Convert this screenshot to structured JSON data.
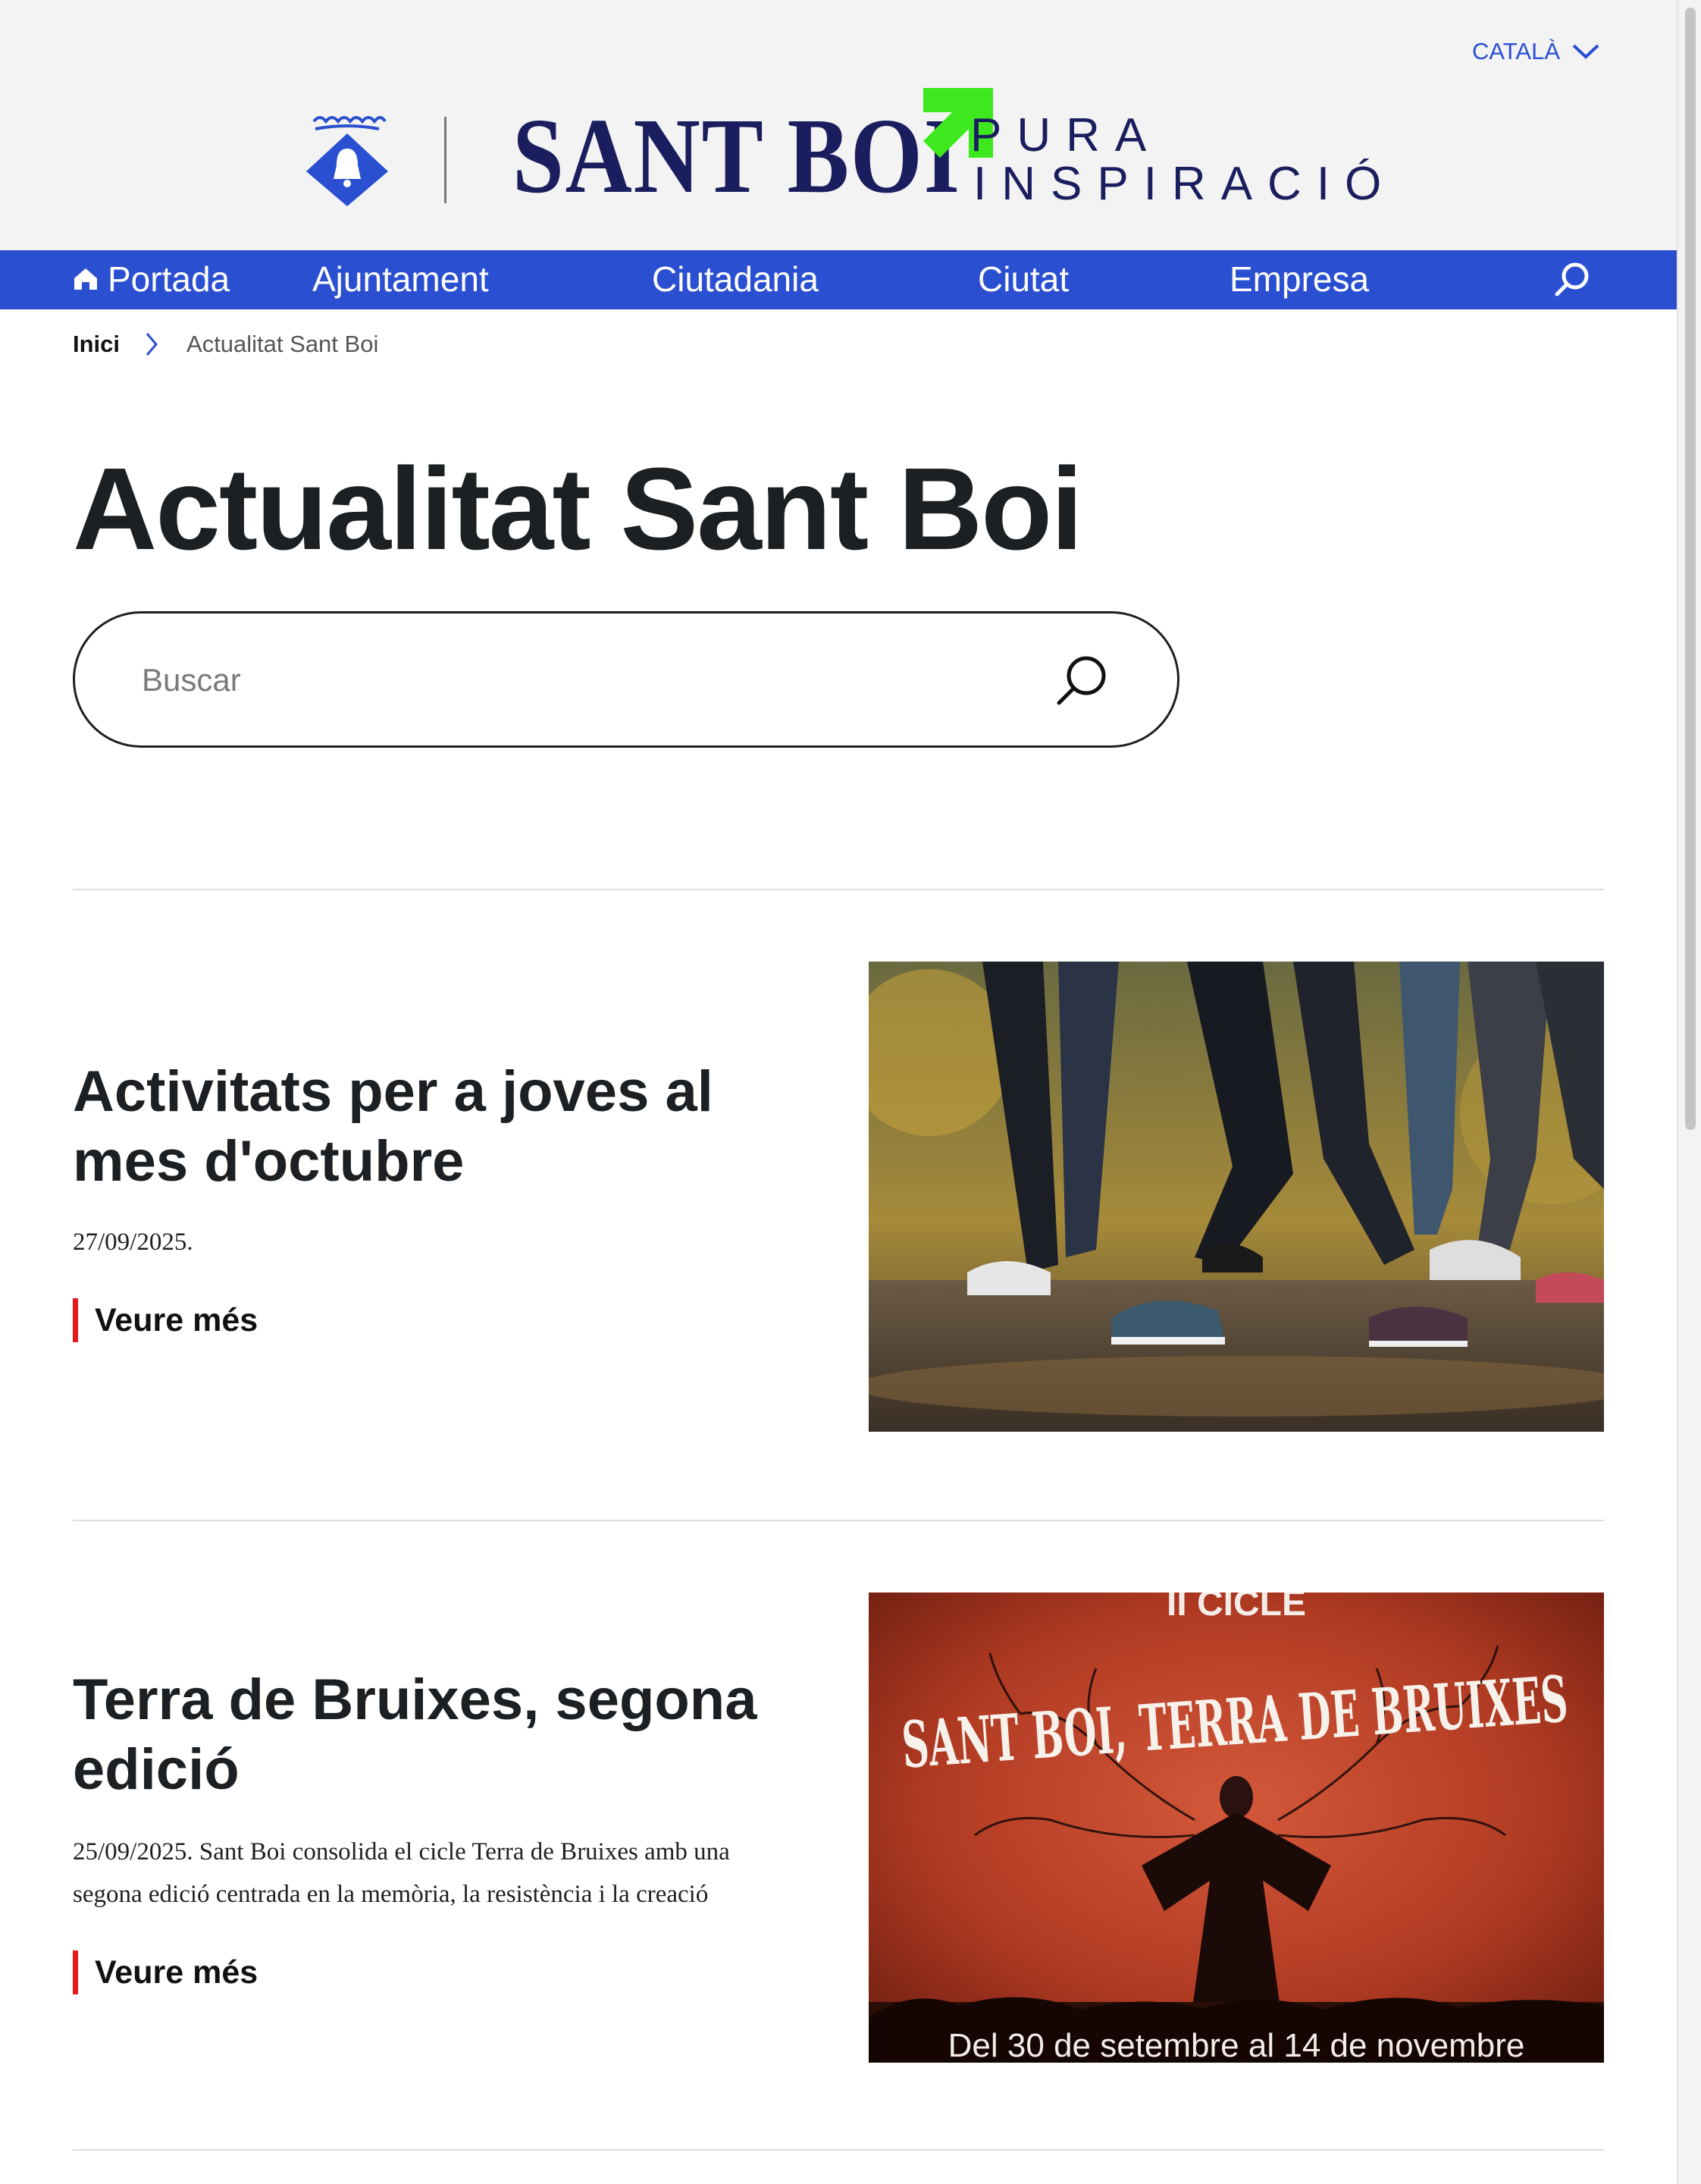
{
  "header": {
    "language": "CATALÀ",
    "brand_main": "SANT BOI",
    "brand_line1": "PURA",
    "brand_line2": "INSPIRACIÓ"
  },
  "nav": {
    "items": [
      "Portada",
      "Ajuntament",
      "Ciutadania",
      "Ciutat",
      "Empresa"
    ]
  },
  "breadcrumb": {
    "home": "Inici",
    "current": "Actualitat Sant Boi"
  },
  "page": {
    "title": "Actualitat Sant Boi"
  },
  "search": {
    "placeholder": "Buscar"
  },
  "news": [
    {
      "title": "Activitats per a joves al mes d'octubre",
      "text": "27/09/2025.",
      "link": "Veure més"
    },
    {
      "title": "Terra de Bruixes, segona edició",
      "text": "25/09/2025. Sant Boi consolida el cicle Terra de Bruixes amb una segona edició centrada en la memòria, la resistència i la creació",
      "link": "Veure més",
      "poster_top": "II CICLE",
      "poster_title": "SANT BOI, TERRA DE BRUIXES",
      "poster_dates": "Del 30 de setembre al 14 de novembre"
    }
  ],
  "colors": {
    "nav_blue": "#2a4fd1",
    "brand_navy": "#1b1e5e",
    "brand_green": "#3ee81e",
    "link_accent": "#e21b1b",
    "header_bg": "#f3f3f3"
  },
  "icons": {
    "lang": "chevron-down-icon",
    "home": "home-icon",
    "nav_search": "search-icon",
    "breadcrumb": "chevron-right-icon",
    "search": "search-icon"
  }
}
